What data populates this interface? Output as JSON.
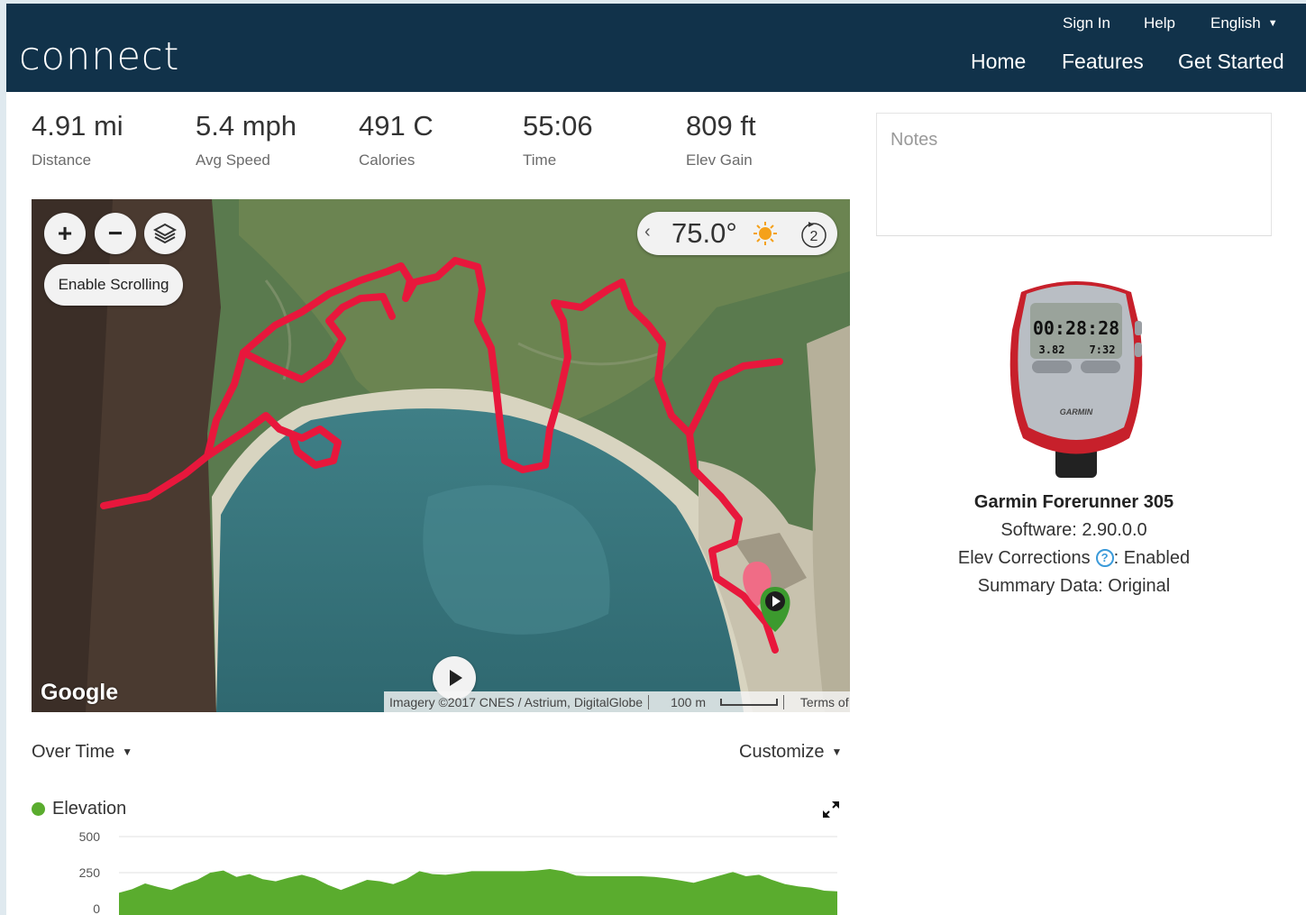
{
  "header": {
    "logo": "connect",
    "top_links": [
      "Sign In",
      "Help",
      "English"
    ],
    "nav": [
      "Home",
      "Features",
      "Get Started"
    ]
  },
  "stats": [
    {
      "value": "4.91 mi",
      "label": "Distance"
    },
    {
      "value": "5.4 mph",
      "label": "Avg Speed"
    },
    {
      "value": "491 C",
      "label": "Calories"
    },
    {
      "value": "55:06",
      "label": "Time"
    },
    {
      "value": "809 ft",
      "label": "Elev Gain"
    }
  ],
  "notes": {
    "placeholder": "Notes"
  },
  "map": {
    "scroll_label": "Enable Scrolling",
    "temperature": "75.0°",
    "wind_speed": "2",
    "provider": "Google",
    "imagery": "Imagery ©2017 CNES / Astrium, DigitalGlobe",
    "scale": "100 m",
    "terms": "Terms of Use",
    "route_color": "#e8173c"
  },
  "chart_controls": {
    "over_time": "Over Time",
    "customize": "Customize"
  },
  "chart_data": {
    "type": "area",
    "legend": "Elevation",
    "color": "#5aac2e",
    "yticks": [
      "500",
      "250",
      "0"
    ],
    "ylim": [
      0,
      500
    ],
    "values": [
      110,
      135,
      175,
      150,
      130,
      170,
      200,
      250,
      265,
      220,
      240,
      205,
      190,
      215,
      235,
      210,
      165,
      130,
      165,
      200,
      190,
      170,
      205,
      260,
      240,
      235,
      245,
      260,
      260,
      260,
      260,
      260,
      265,
      275,
      260,
      230,
      225,
      225,
      225,
      225,
      225,
      220,
      210,
      195,
      180,
      205,
      230,
      255,
      225,
      235,
      200,
      170,
      155,
      145,
      125,
      120
    ]
  },
  "device": {
    "name": "Garmin Forerunner 305",
    "software": "Software: 2.90.0.0",
    "elev_label": "Elev Corrections",
    "elev_value": ": Enabled",
    "summary": "Summary Data: Original",
    "screen_time": "00:28:28",
    "screen_distance": "3.82",
    "screen_pace": "7:32",
    "brand": "GARMIN"
  }
}
